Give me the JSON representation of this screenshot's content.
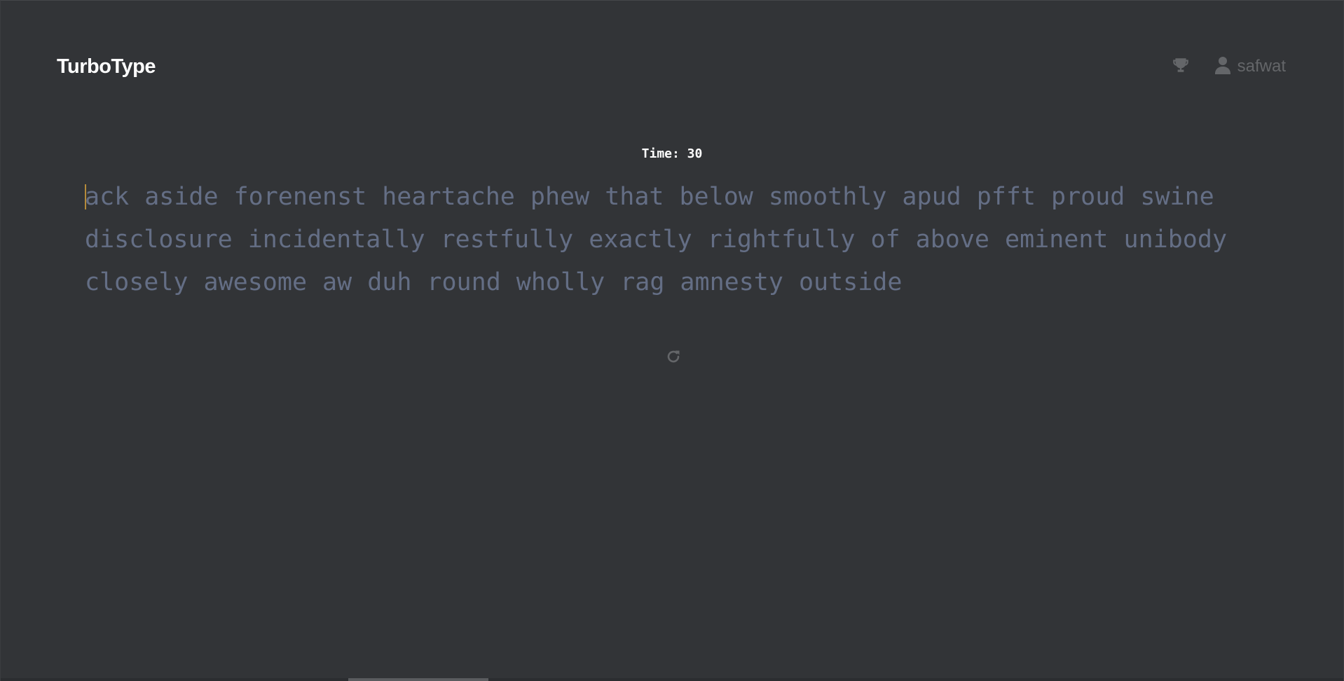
{
  "app": {
    "logo": "TurboType"
  },
  "header": {
    "leaderboard_icon": "trophy-icon",
    "user_icon": "user-icon",
    "username": "safwat"
  },
  "test": {
    "timer_label": "Time: 30",
    "words": [
      "ack",
      "aside",
      "forenenst",
      "heartache",
      "phew",
      "that",
      "below",
      "smoothly",
      "apud",
      "pfft",
      "proud",
      "swine",
      "disclosure",
      "incidentally",
      "restfully",
      "exactly",
      "rightfully",
      "of",
      "above",
      "eminent",
      "unibody",
      "closely",
      "awesome",
      "aw",
      "duh",
      "round",
      "wholly",
      "rag",
      "amnesty",
      "outside"
    ],
    "restart_icon": "restart-icon"
  },
  "colors": {
    "background": "#323437",
    "text_untyped": "#646e85",
    "caret": "#b58a3a",
    "muted": "#646669",
    "white": "#ffffff"
  }
}
